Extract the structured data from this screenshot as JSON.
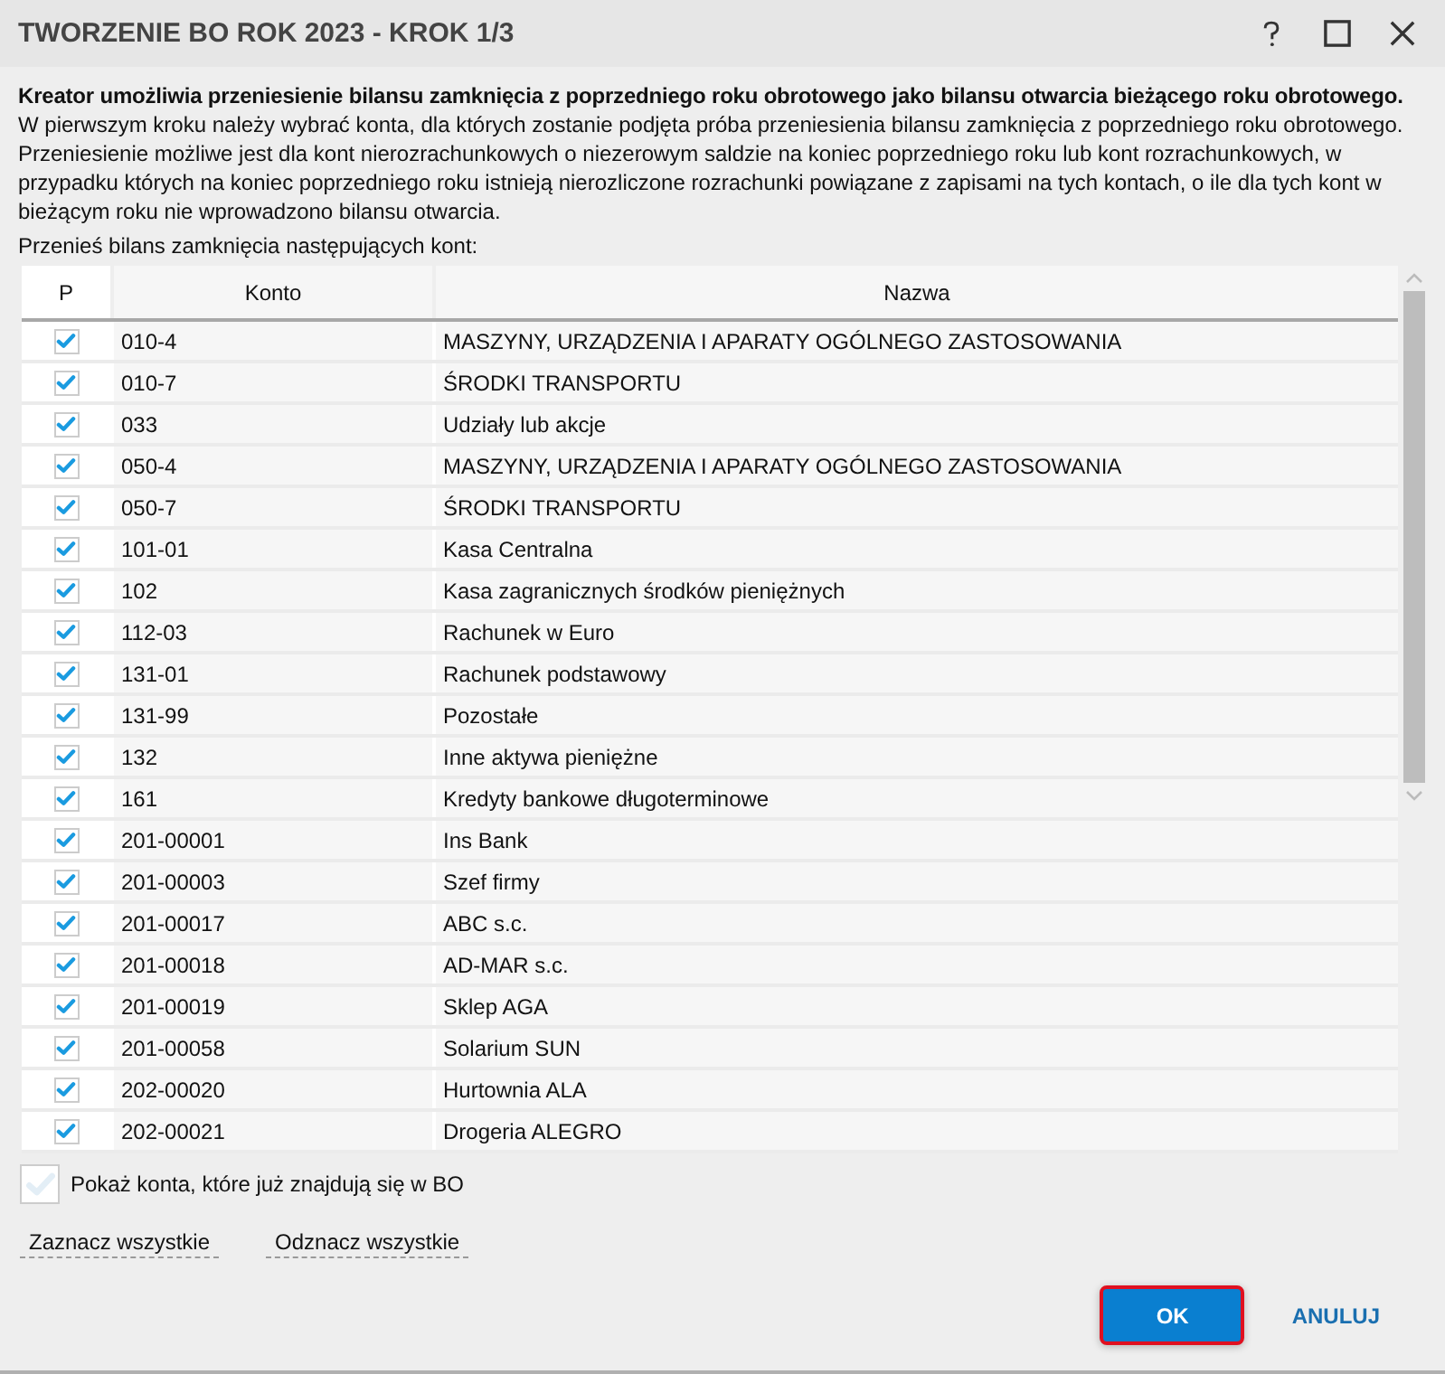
{
  "window": {
    "title": "TWORZENIE BO ROK 2023 - KROK 1/3"
  },
  "intro": {
    "heading": "Kreator umożliwia przeniesienie bilansu zamknięcia z poprzedniego roku obrotowego jako bilansu otwarcia bieżącego roku obrotowego.",
    "text": "W pierwszym kroku należy wybrać konta, dla których zostanie podjęta próba przeniesienia bilansu zamknięcia z poprzedniego roku obrotowego. Przeniesienie możliwe jest dla kont nierozrachunkowych o niezerowym saldzie na koniec poprzedniego roku lub kont rozrachunkowych, w przypadku których na koniec poprzedniego roku istnieją nierozliczone rozrachunki powiązane z zapisami na tych kontach, o ile dla tych kont w bieżącym roku nie wprowadzono bilansu otwarcia."
  },
  "table_label": "Przenieś bilans zamknięcia następujących kont:",
  "table": {
    "columns": [
      "P",
      "Konto",
      "Nazwa"
    ],
    "rows": [
      {
        "checked": true,
        "konto": "010-4",
        "nazwa": "MASZYNY, URZĄDZENIA I APARATY OGÓLNEGO ZASTOSOWANIA"
      },
      {
        "checked": true,
        "konto": "010-7",
        "nazwa": "ŚRODKI TRANSPORTU"
      },
      {
        "checked": true,
        "konto": "033",
        "nazwa": "Udziały lub akcje"
      },
      {
        "checked": true,
        "konto": "050-4",
        "nazwa": "MASZYNY, URZĄDZENIA I APARATY OGÓLNEGO ZASTOSOWANIA"
      },
      {
        "checked": true,
        "konto": "050-7",
        "nazwa": "ŚRODKI TRANSPORTU"
      },
      {
        "checked": true,
        "konto": "101-01",
        "nazwa": "Kasa Centralna"
      },
      {
        "checked": true,
        "konto": "102",
        "nazwa": "Kasa zagranicznych środków pieniężnych"
      },
      {
        "checked": true,
        "konto": "112-03",
        "nazwa": "Rachunek w Euro"
      },
      {
        "checked": true,
        "konto": "131-01",
        "nazwa": "Rachunek podstawowy"
      },
      {
        "checked": true,
        "konto": "131-99",
        "nazwa": "Pozostałe"
      },
      {
        "checked": true,
        "konto": "132",
        "nazwa": "Inne aktywa pieniężne"
      },
      {
        "checked": true,
        "konto": "161",
        "nazwa": "Kredyty bankowe długoterminowe"
      },
      {
        "checked": true,
        "konto": "201-00001",
        "nazwa": "Ins Bank"
      },
      {
        "checked": true,
        "konto": "201-00003",
        "nazwa": "Szef firmy"
      },
      {
        "checked": true,
        "konto": "201-00017",
        "nazwa": "ABC s.c."
      },
      {
        "checked": true,
        "konto": "201-00018",
        "nazwa": "AD-MAR s.c."
      },
      {
        "checked": true,
        "konto": "201-00019",
        "nazwa": "Sklep AGA"
      },
      {
        "checked": true,
        "konto": "201-00058",
        "nazwa": "Solarium SUN"
      },
      {
        "checked": true,
        "konto": "202-00020",
        "nazwa": "Hurtownia ALA"
      },
      {
        "checked": true,
        "konto": "202-00021",
        "nazwa": "Drogeria ALEGRO"
      }
    ]
  },
  "show_existing": {
    "label": "Pokaż konta, które już znajdują się w BO",
    "checked": false
  },
  "links": [
    "Zaznacz wszystkie",
    "Odznacz wszystkie"
  ],
  "buttons": [
    {
      "label": "OK",
      "kind": "primary"
    },
    {
      "label": "ANULUJ",
      "kind": "text"
    }
  ]
}
